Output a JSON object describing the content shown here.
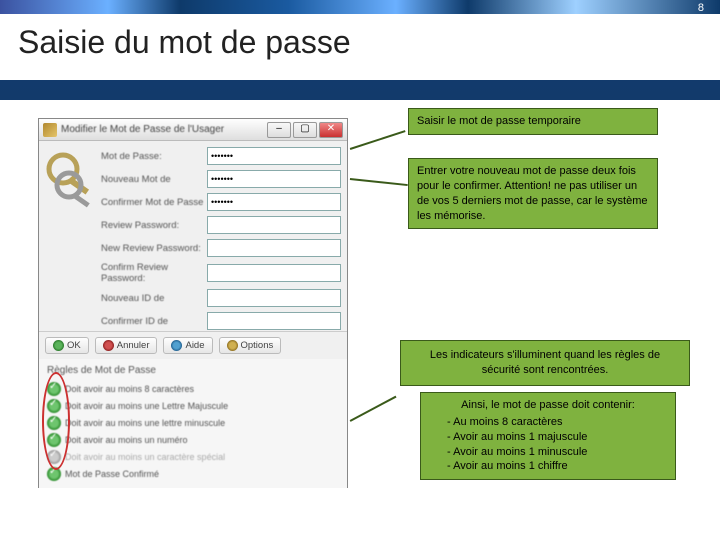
{
  "slide": {
    "title": "Saisie du mot de passe",
    "page_number": "8"
  },
  "dialog": {
    "title": "Modifier le Mot de Passe de l'Usager",
    "fields": [
      {
        "label": "Mot de Passe:",
        "value": "•••••••"
      },
      {
        "label": "Nouveau Mot de",
        "value": "•••••••"
      },
      {
        "label": "Confirmer Mot de Passe",
        "value": "•••••••"
      },
      {
        "label": "Review Password:",
        "value": ""
      },
      {
        "label": "New Review Password:",
        "value": ""
      },
      {
        "label": "Confirm Review Password:",
        "value": ""
      },
      {
        "label": "Nouveau ID de",
        "value": ""
      },
      {
        "label": "Confirmer ID de",
        "value": ""
      }
    ],
    "buttons": {
      "ok": "OK",
      "cancel": "Annuler",
      "help": "Aide",
      "options": "Options"
    },
    "rules_title": "Règles de Mot de Passe",
    "rules": [
      {
        "text": "Doit avoir au moins 8 caractères",
        "met": true
      },
      {
        "text": "Doit avoir au moins une Lettre Majuscule",
        "met": true
      },
      {
        "text": "Doit avoir au moins une lettre minuscule",
        "met": true
      },
      {
        "text": "Doit avoir au moins un numéro",
        "met": true
      },
      {
        "text": "Doit avoir au moins un caractère spécial",
        "met": false
      },
      {
        "text": "Mot de Passe Confirmé",
        "met": true
      }
    ]
  },
  "callouts": {
    "c1": "Saisir le mot de passe temporaire",
    "c2": "Entrer votre nouveau mot de passe deux fois pour le confirmer. Attention! ne pas utiliser un de vos 5 derniers mot de passe, car le système les mémorise.",
    "c3": "Les indicateurs s'illuminent quand les règles de sécurité sont rencontrées.",
    "c4_title": "Ainsi, le mot de passe doit contenir:",
    "c4_items": [
      "- Au moins 8 caractères",
      "- Avoir au moins 1 majuscule",
      "- Avoir au moins 1 minuscule",
      "- Avoir au moins 1 chiffre"
    ]
  }
}
